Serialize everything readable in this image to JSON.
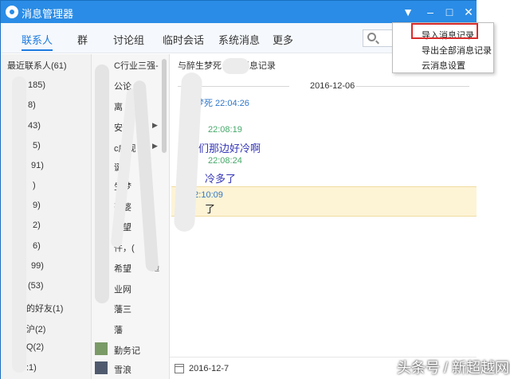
{
  "window": {
    "title": "消息管理器"
  },
  "nav": {
    "tabs": [
      "联系人",
      "群",
      "讨论组",
      "临时会话",
      "系统消息",
      "更多"
    ],
    "active_index": 0
  },
  "left_panel": {
    "header": "最近联系人(61)",
    "items": [
      "185)",
      "8)",
      "43)",
      "5)",
      "91)",
      ")",
      "9)",
      "2)",
      "6)",
      "99)",
      "(53)",
      "的好友(1)",
      "沪(2)",
      "Q(2)",
      ":1)"
    ]
  },
  "middle_panel": {
    "items": [
      "C行业三强-",
      "公论",
      "离",
      "安鹏",
      "c威视",
      "诞",
      "生梦",
      "豪婆",
      "希望",
      "件，(",
      "希望",
      "业网",
      "藩三",
      "藩",
      "勤务记",
      "雪浪"
    ],
    "side_icons": [
      "边"
    ]
  },
  "chat": {
    "header": "与醉生梦死        0)的消息记录",
    "date_separator": "2016-12-06",
    "messages": [
      {
        "meta": "梦死 22:04:26",
        "text": ""
      },
      {
        "meta": "22:08:19",
        "text": "们那边好冷啊"
      },
      {
        "meta": "22:08:24",
        "text": "冷多了"
      },
      {
        "meta": "死 22:10:09",
        "text": "了"
      }
    ],
    "footer_date": "2016-12-7"
  },
  "dropdown_menu": {
    "items": [
      "导入消息记录",
      "导出全部消息记录",
      "云消息设置"
    ],
    "highlighted_index": 0
  },
  "watermark": "头条号 / 新超越网络",
  "colors": {
    "titlebar": "#2a8ce6",
    "accent": "#1e7be0",
    "highlight_box": "#d92b2b",
    "msg_highlight": "#fdf3d5"
  }
}
